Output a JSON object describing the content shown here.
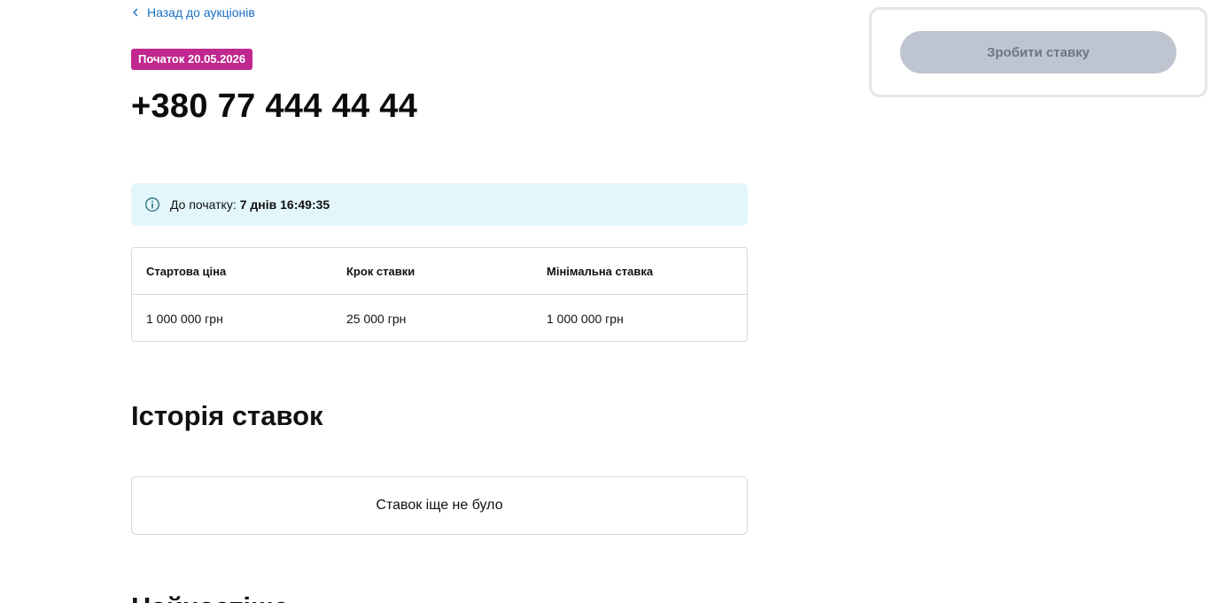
{
  "nav": {
    "back_label": "Назад до аукціонів"
  },
  "lot": {
    "start_badge": "Початок 20.05.2026",
    "title": "+380 77 444 44 44"
  },
  "countdown": {
    "label": "До початку:",
    "value": "7 днів 16:49:35"
  },
  "price_table": {
    "headers": [
      "Стартова ціна",
      "Крок ставки",
      "Мінімальна ставка"
    ],
    "values": [
      "1 000 000 грн",
      "25 000 грн",
      "1 000 000 грн"
    ]
  },
  "history": {
    "title": "Історія ставок",
    "empty_text": "Ставок іще не було"
  },
  "next_section": {
    "title": "Найчастіше"
  },
  "bid_panel": {
    "button_label": "Зробити ставку"
  },
  "colors": {
    "accent_link": "#1a6fc4",
    "badge": "#c0288f",
    "info_bg": "#e3f6fb",
    "button_disabled": "#bfc5d0"
  },
  "icons": {
    "back": "chevron-left-icon",
    "info": "info-icon"
  }
}
